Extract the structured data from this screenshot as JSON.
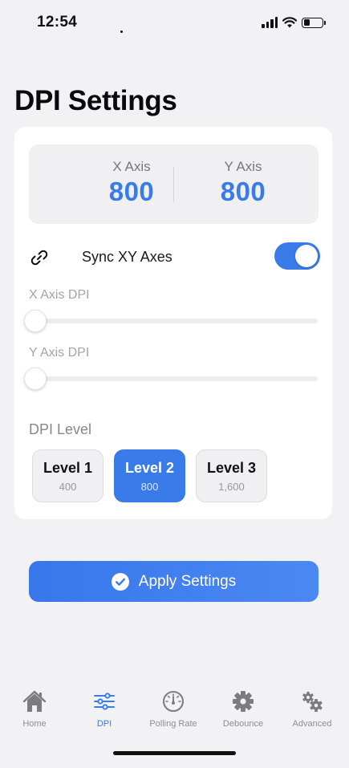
{
  "status_bar": {
    "time": "12:54"
  },
  "page": {
    "title": "DPI Settings"
  },
  "axes": {
    "x_label": "X Axis",
    "x_value": "800",
    "y_label": "Y Axis",
    "y_value": "800"
  },
  "sync": {
    "label": "Sync XY Axes",
    "enabled": true,
    "icon": "link-icon"
  },
  "sliders": {
    "x_label": "X Axis DPI",
    "x_level": 0,
    "y_label": "Y Axis DPI",
    "y_level": 0
  },
  "dpi_levels": {
    "title": "DPI Level",
    "items": [
      {
        "name": "Level 1",
        "dpi": "400",
        "active": false
      },
      {
        "name": "Level 2",
        "dpi": "800",
        "active": true
      },
      {
        "name": "Level 3",
        "dpi": "1,600",
        "active": false
      }
    ]
  },
  "apply": {
    "label": "Apply Settings",
    "icon": "checkmark-circle-icon"
  },
  "tabs": [
    {
      "label": "Home",
      "icon": "home-icon",
      "active": false
    },
    {
      "label": "DPI",
      "icon": "sliders-icon",
      "active": true
    },
    {
      "label": "Polling Rate",
      "icon": "gauge-icon",
      "active": false
    },
    {
      "label": "Debounce",
      "icon": "gear-icon",
      "active": false
    },
    {
      "label": "Advanced",
      "icon": "gears-icon",
      "active": false
    }
  ],
  "colors": {
    "accent": "#3a7bea",
    "background": "#f2f2f4",
    "card": "#ffffff"
  }
}
